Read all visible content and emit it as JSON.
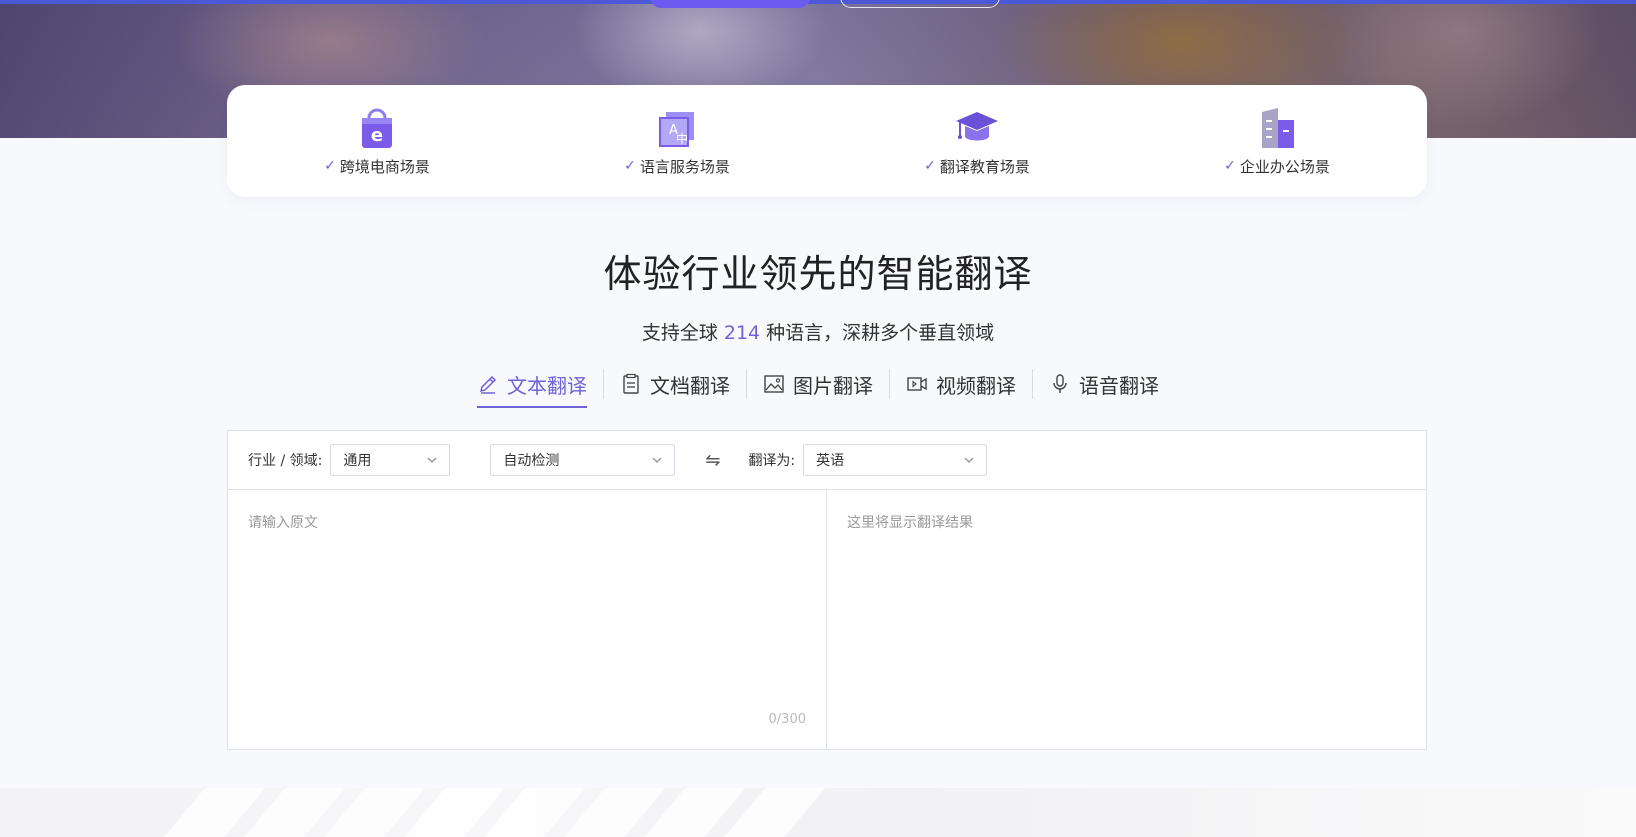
{
  "hero": {},
  "scenes": [
    {
      "label": "跨境电商场景",
      "icon": "shopping-bag-icon"
    },
    {
      "label": "语言服务场景",
      "icon": "language-translate-icon"
    },
    {
      "label": "翻译教育场景",
      "icon": "graduation-cap-icon"
    },
    {
      "label": "企业办公场景",
      "icon": "office-building-icon"
    }
  ],
  "headline": "体验行业领先的智能翻译",
  "subhead": {
    "before": "支持全球 ",
    "count": "214",
    "after": " 种语言，深耕多个垂直领域"
  },
  "tabs": [
    {
      "label": "文本翻译",
      "icon": "pencil-icon",
      "active": true
    },
    {
      "label": "文档翻译",
      "icon": "document-icon",
      "active": false
    },
    {
      "label": "图片翻译",
      "icon": "image-icon",
      "active": false
    },
    {
      "label": "视频翻译",
      "icon": "video-icon",
      "active": false
    },
    {
      "label": "语音翻译",
      "icon": "microphone-icon",
      "active": false
    }
  ],
  "toolbar": {
    "domain_label": "行业 / 领域:",
    "domain_value": "通用",
    "source_lang": "自动检测",
    "swap_symbol": "⇋",
    "target_label": "翻译为:",
    "target_value": "英语"
  },
  "source": {
    "placeholder": "请输入原文",
    "counter": "0/300"
  },
  "result": {
    "placeholder": "这里将显示翻译结果"
  },
  "colors": {
    "accent": "#6f63d6",
    "icon_purple": "#7b5ce8"
  }
}
